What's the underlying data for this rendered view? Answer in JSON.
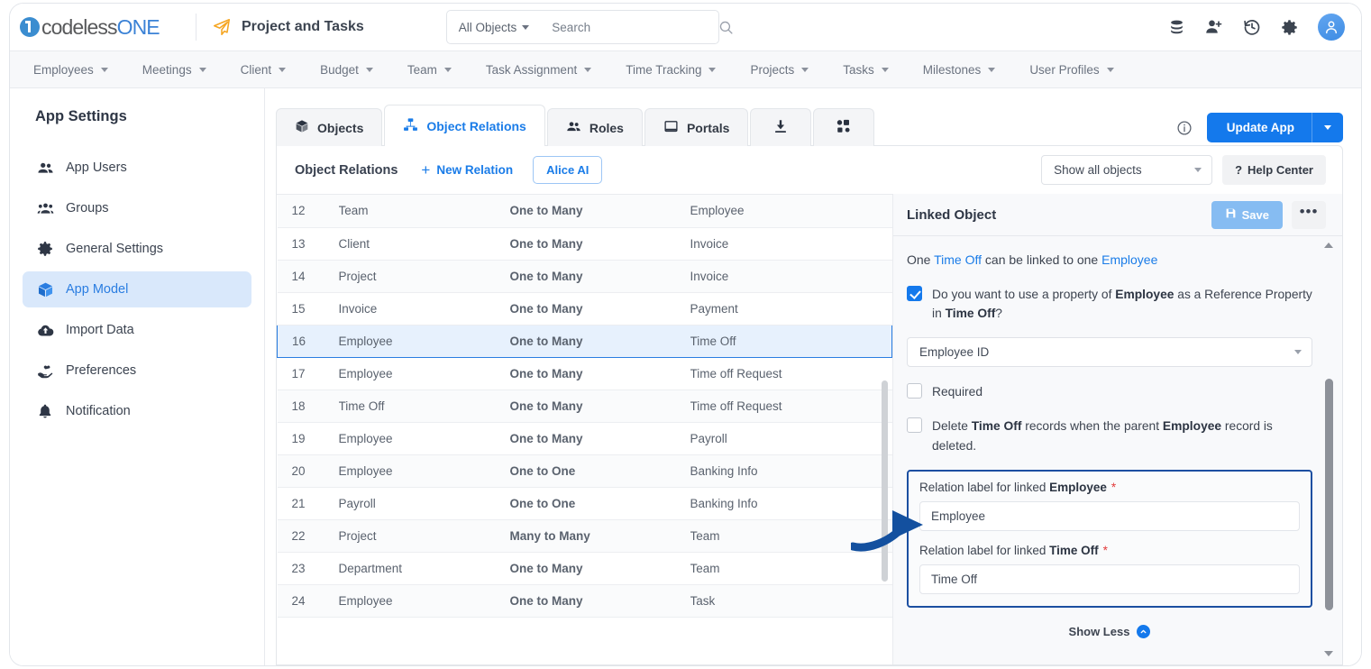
{
  "topbar": {
    "logo_text_1": "codeless",
    "logo_text_2": "ONE",
    "project_title": "Project and Tasks",
    "search": {
      "scope_label": "All Objects",
      "placeholder": "Search",
      "value": ""
    },
    "icons": [
      "database-icon",
      "add-user-icon",
      "history-icon",
      "gear-icon",
      "avatar"
    ]
  },
  "menubar": {
    "items": [
      {
        "label": "Employees"
      },
      {
        "label": "Meetings"
      },
      {
        "label": "Client"
      },
      {
        "label": "Budget"
      },
      {
        "label": "Team"
      },
      {
        "label": "Task Assignment"
      },
      {
        "label": "Time Tracking"
      },
      {
        "label": "Projects"
      },
      {
        "label": "Tasks"
      },
      {
        "label": "Milestones"
      },
      {
        "label": "User Profiles"
      }
    ]
  },
  "sidebar": {
    "title": "App Settings",
    "items": [
      {
        "label": "App Users",
        "icon": "users-icon",
        "active": false
      },
      {
        "label": "Groups",
        "icon": "group-icon",
        "active": false
      },
      {
        "label": "General Settings",
        "icon": "gear-icon",
        "active": false
      },
      {
        "label": "App Model",
        "icon": "cube-icon",
        "active": true
      },
      {
        "label": "Import Data",
        "icon": "cloud-upload-icon",
        "active": false
      },
      {
        "label": "Preferences",
        "icon": "hand-heart-icon",
        "active": false
      },
      {
        "label": "Notification",
        "icon": "bell-icon",
        "active": false
      }
    ]
  },
  "tabs": [
    {
      "label": "Objects",
      "icon": "cube-icon",
      "active": false
    },
    {
      "label": "Object Relations",
      "icon": "relations-icon",
      "active": true
    },
    {
      "label": "Roles",
      "icon": "users-icon",
      "active": false
    },
    {
      "label": "Portals",
      "icon": "portal-icon",
      "active": false
    },
    {
      "label": "",
      "icon": "download-icon",
      "active": false
    },
    {
      "label": "",
      "icon": "integration-icon",
      "active": false
    }
  ],
  "header_actions": {
    "info_icon": "info-icon",
    "update_label": "Update App"
  },
  "toolbar": {
    "section_title": "Object Relations",
    "new_relation_label": "New Relation",
    "alice_ai_label": "Alice AI",
    "filter_value": "Show all objects",
    "help_label": "Help Center"
  },
  "table": {
    "rows": [
      {
        "id": "12",
        "from": "Team",
        "type": "One to Many",
        "to": "Employee",
        "selected": false
      },
      {
        "id": "13",
        "from": "Client",
        "type": "One to Many",
        "to": "Invoice",
        "selected": false
      },
      {
        "id": "14",
        "from": "Project",
        "type": "One to Many",
        "to": "Invoice",
        "selected": false
      },
      {
        "id": "15",
        "from": "Invoice",
        "type": "One to Many",
        "to": "Payment",
        "selected": false
      },
      {
        "id": "16",
        "from": "Employee",
        "type": "One to Many",
        "to": "Time Off",
        "selected": true
      },
      {
        "id": "17",
        "from": "Employee",
        "type": "One to Many",
        "to": "Time off Request",
        "selected": false
      },
      {
        "id": "18",
        "from": "Time Off",
        "type": "One to Many",
        "to": "Time off Request",
        "selected": false
      },
      {
        "id": "19",
        "from": "Employee",
        "type": "One to Many",
        "to": "Payroll",
        "selected": false
      },
      {
        "id": "20",
        "from": "Employee",
        "type": "One to One",
        "to": "Banking Info",
        "selected": false
      },
      {
        "id": "21",
        "from": "Payroll",
        "type": "One to One",
        "to": "Banking Info",
        "selected": false
      },
      {
        "id": "22",
        "from": "Project",
        "type": "Many to Many",
        "to": "Team",
        "selected": false
      },
      {
        "id": "23",
        "from": "Department",
        "type": "One to Many",
        "to": "Team",
        "selected": false
      },
      {
        "id": "24",
        "from": "Employee",
        "type": "One to Many",
        "to": "Task",
        "selected": false
      }
    ]
  },
  "panel": {
    "title": "Linked Object",
    "save_label": "Save",
    "more_label": "•••",
    "relation_sentence": {
      "p1": "One ",
      "obj1": "Time Off",
      "p2": " can be linked to one ",
      "obj2": "Employee"
    },
    "reference_checkbox": {
      "checked": true,
      "text_1": "Do you want to use a property of ",
      "bold_1": "Employee",
      "text_2": " as a Reference Property in ",
      "bold_2": "Time Off",
      "text_3": "?"
    },
    "reference_property_value": "Employee ID",
    "required_checkbox": {
      "checked": false,
      "label": "Required"
    },
    "delete_checkbox": {
      "checked": false,
      "text_1": "Delete ",
      "bold_1": "Time Off",
      "text_2": " records when the parent ",
      "bold_2": "Employee",
      "text_3": " record is deleted."
    },
    "relation_label_1": {
      "text_1": "Relation label for linked ",
      "bold_1": "Employee",
      "star": "*",
      "value": "Employee"
    },
    "relation_label_2": {
      "text_1": "Relation label for linked ",
      "bold_1": "Time Off",
      "star": "*",
      "value": "Time Off"
    },
    "show_less_label": "Show Less"
  },
  "annotation": {
    "arrow": "curved-right-arrow",
    "color": "#13509f"
  }
}
